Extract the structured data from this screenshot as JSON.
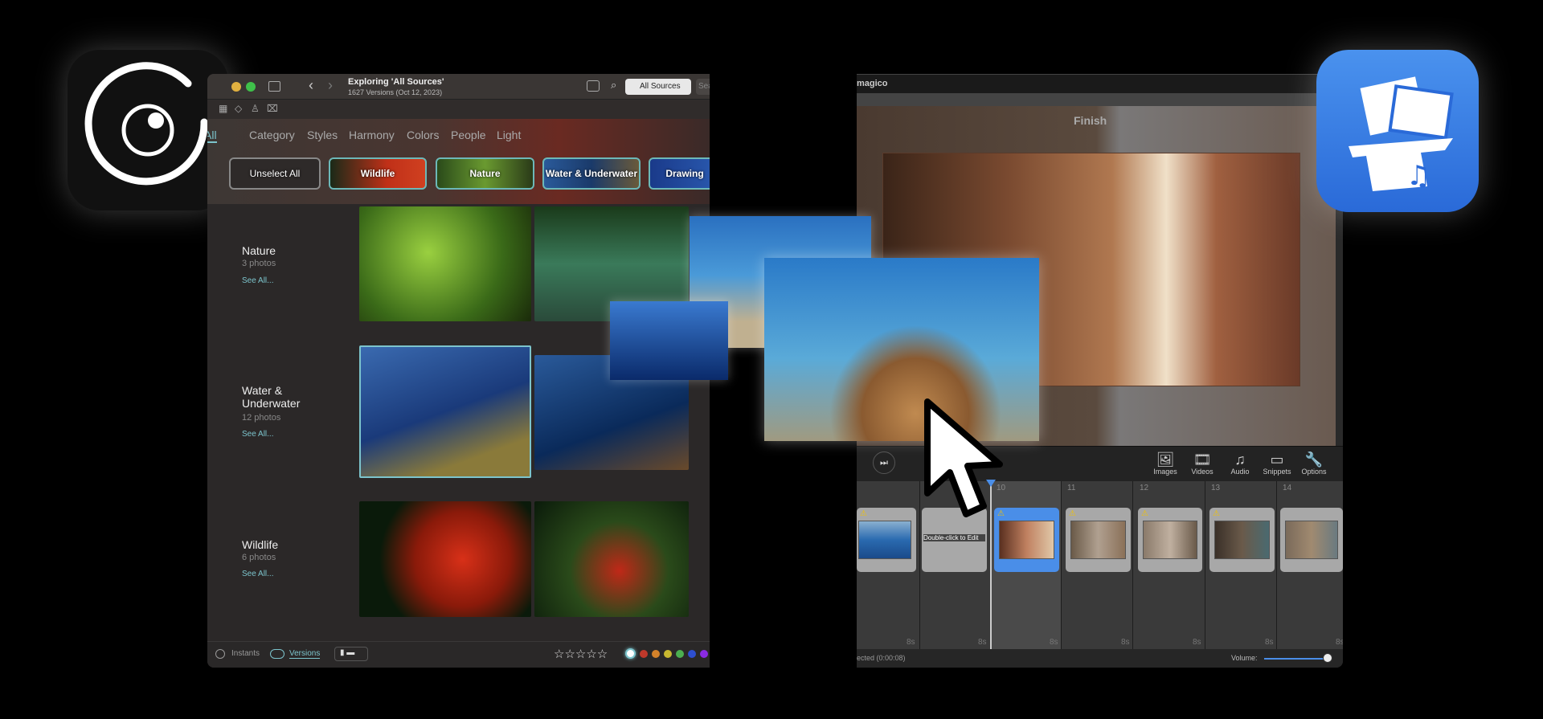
{
  "left_app": {
    "title": "Exploring 'All Sources'",
    "subtitle": "1627 Versions (Oct 12, 2023)",
    "source_button": "All Sources",
    "search_placeholder": "Search",
    "tabs": [
      "All",
      "Category",
      "Styles",
      "Harmony",
      "Colors",
      "People",
      "Light"
    ],
    "chips": [
      "Unselect All",
      "Wildlife",
      "Nature",
      "Water & Underwater",
      "Drawing"
    ],
    "sections": [
      {
        "name": "Nature",
        "count": "3 photos",
        "link": "See All..."
      },
      {
        "name": "Water & Underwater",
        "count": "12 photos",
        "link": "See All..."
      },
      {
        "name": "Wildlife",
        "count": "6 photos",
        "link": "See All..."
      }
    ],
    "footer": {
      "instants": "Instants",
      "versions": "Versions",
      "stars": "☆☆☆☆☆",
      "rating": 0,
      "color_labels": [
        "#ffffff",
        "#c0392b",
        "#d4822a",
        "#c8b830",
        "#4caf50",
        "#2e4fd0",
        "#8a2be2"
      ]
    }
  },
  "right_app": {
    "title": "magico",
    "preview_label": "Finish",
    "toolbar": [
      "Images",
      "Videos",
      "Audio",
      "Snippets",
      "Options"
    ],
    "ruler": [
      "10",
      "11",
      "12",
      "13",
      "14"
    ],
    "clip_text": "Double-click to Edit",
    "duration": "8s",
    "status": "ected (0:00:08)",
    "volume_label": "Volume:",
    "volume": 1.0
  },
  "colors": {
    "accent_teal": "#6cb8b8",
    "timeline_selected": "#4a8ee8",
    "magico_icon": "#3a82e6"
  }
}
